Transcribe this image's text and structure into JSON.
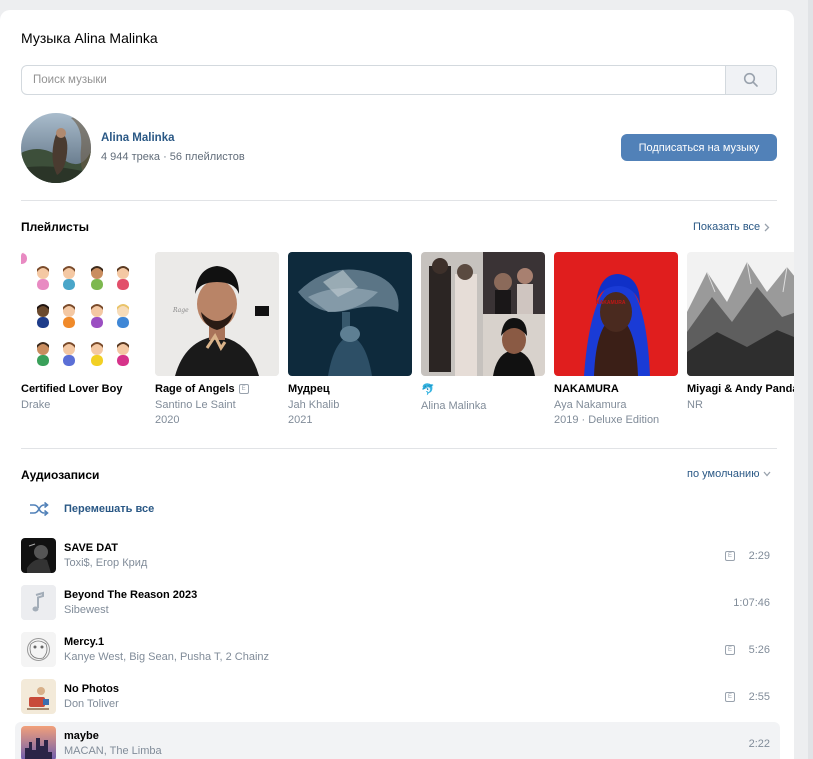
{
  "page": {
    "title": "Музыка Alina Malinka"
  },
  "search": {
    "placeholder": "Поиск музыки",
    "value": ""
  },
  "profile": {
    "name": "Alina Malinka",
    "stats": "4 944 трека · 56 плейлистов",
    "subscribe_label": "Подписаться на музыку"
  },
  "playlists_section": {
    "title": "Плейлисты",
    "show_all": "Показать все"
  },
  "playlists": [
    {
      "title": "Certified Lover Boy",
      "artist": "Drake",
      "year": "",
      "explicit": false
    },
    {
      "title": "Rage of Angels",
      "artist": "Santino Le Saint",
      "year": "2020",
      "explicit": true
    },
    {
      "title": "Мудрец",
      "artist": "Jah Khalib",
      "year": "2021",
      "explicit": false
    },
    {
      "title": "🐬",
      "artist": "Alina Malinka",
      "year": "",
      "explicit": false
    },
    {
      "title": "NAKAMURA",
      "artist": "Aya Nakamura",
      "year": "2019 · Deluxe Edition",
      "explicit": false
    },
    {
      "title": "Miyagi & Andy Panda",
      "artist": "NR",
      "year": "",
      "explicit": false
    }
  ],
  "audio_section": {
    "title": "Аудиозаписи",
    "sort": "по умолчанию",
    "shuffle_label": "Перемешать все"
  },
  "tracks": [
    {
      "title": "SAVE DAT",
      "artist": "Toxi$, Егор Крид",
      "duration": "2:29",
      "explicit": true
    },
    {
      "title": "Beyond The Reason 2023",
      "artist": "Sibewest",
      "duration": "1:07:46",
      "explicit": false
    },
    {
      "title": "Mercy.1",
      "artist": "Kanye West, Big Sean, Pusha T, 2 Chainz",
      "duration": "5:26",
      "explicit": true
    },
    {
      "title": "No Photos",
      "artist": "Don Toliver",
      "duration": "2:55",
      "explicit": true
    },
    {
      "title": "maybe",
      "artist": "MACAN, The Limba",
      "duration": "2:22",
      "explicit": false
    }
  ],
  "colors": {
    "accent": "#5181b8",
    "link": "#2a5885",
    "secondary_text": "#818c99",
    "background": "#edeef0"
  }
}
